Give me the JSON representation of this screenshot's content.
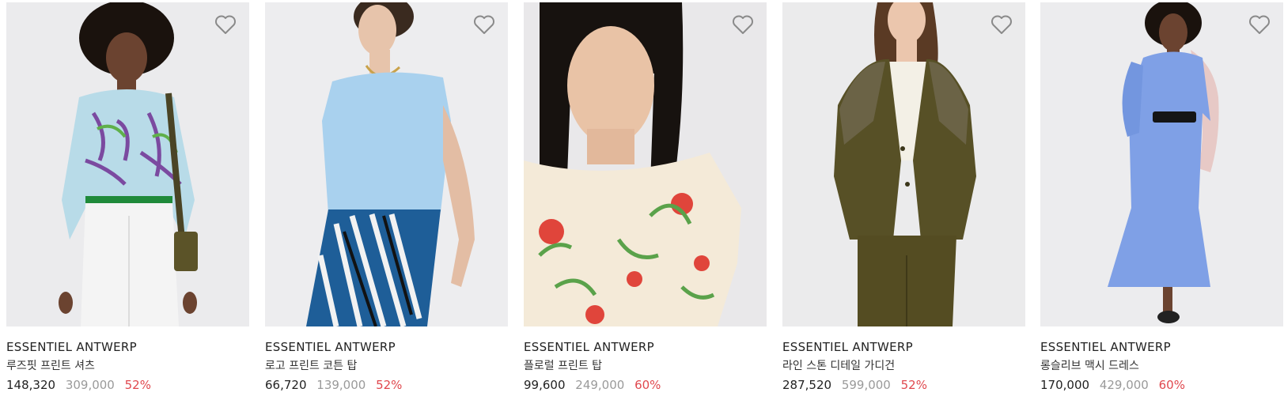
{
  "products": [
    {
      "brand": "ESSENTIEL ANTWERP",
      "name": "루즈핏 프린트 셔츠",
      "sale_price": "148,320",
      "original_price": "309,000",
      "discount": "52%",
      "image_alt": "Model wearing a loose fit printed shirt and white trousers",
      "wishlist_icon": "heart-outline-icon"
    },
    {
      "brand": "ESSENTIEL ANTWERP",
      "name": "로고 프린트 코튼 탑",
      "sale_price": "66,720",
      "original_price": "139,000",
      "discount": "52%",
      "image_alt": "Model wearing a light blue logo print cotton top",
      "wishlist_icon": "heart-outline-icon"
    },
    {
      "brand": "ESSENTIEL ANTWERP",
      "name": "플로럴 프린트 탑",
      "sale_price": "99,600",
      "original_price": "249,000",
      "discount": "60%",
      "image_alt": "Model wearing a floral print top",
      "wishlist_icon": "heart-outline-icon"
    },
    {
      "brand": "ESSENTIEL ANTWERP",
      "name": "라인 스톤 디테일 가디건",
      "sale_price": "287,520",
      "original_price": "599,000",
      "discount": "52%",
      "image_alt": "Model wearing an olive rhinestone detail cardigan",
      "wishlist_icon": "heart-outline-icon"
    },
    {
      "brand": "ESSENTIEL ANTWERP",
      "name": "롱슬리브 맥시 드레스",
      "sale_price": "170,000",
      "original_price": "429,000",
      "discount": "60%",
      "image_alt": "Model wearing a blue long sleeve maxi dress",
      "wishlist_icon": "heart-outline-icon"
    }
  ],
  "colors": {
    "text": "#222222",
    "original_price": "#9a9a9a",
    "discount": "#e0484e",
    "image_background": "#ececee"
  }
}
